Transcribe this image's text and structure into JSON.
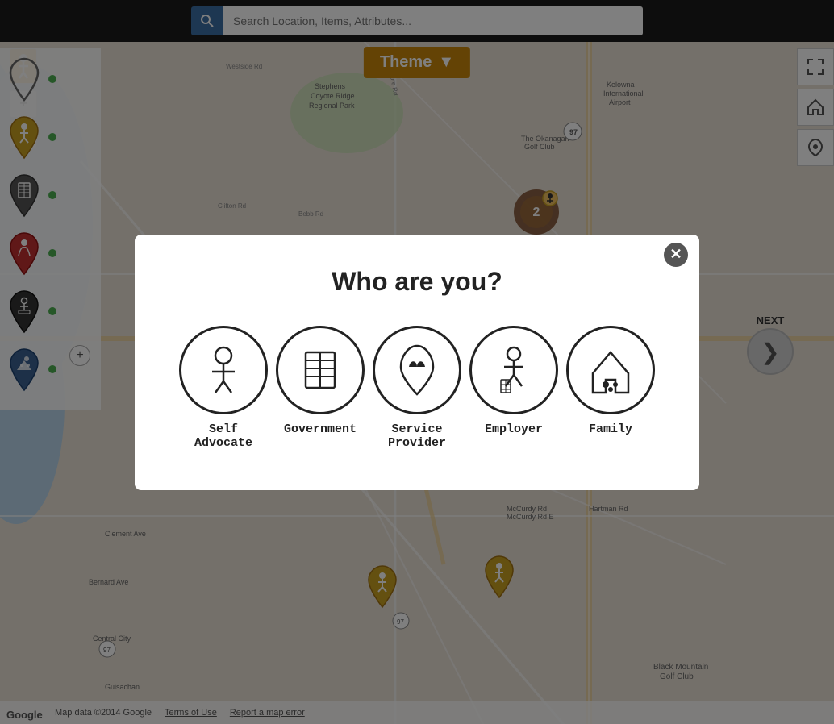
{
  "app": {
    "title": "Who are you?"
  },
  "topbar": {
    "search_placeholder": "Search Location, Items, Attributes..."
  },
  "theme_button": {
    "label": "Theme",
    "arrow": "▼"
  },
  "map_controls": {
    "zoom_in": "+",
    "zoom_out": "−",
    "add": "+"
  },
  "next_button": {
    "label": "NEXT",
    "arrow": "❯"
  },
  "modal": {
    "title": "Who are you?",
    "close": "✕",
    "roles": [
      {
        "id": "self-advocate",
        "label": "Self Advocate"
      },
      {
        "id": "government",
        "label": "Government"
      },
      {
        "id": "service-provider",
        "label": "Service Provider"
      },
      {
        "id": "employer",
        "label": "Employer"
      },
      {
        "id": "family",
        "label": "Family"
      }
    ]
  },
  "bottom_bar": {
    "map_data": "Map data ©2014 Google",
    "terms": "Terms of Use",
    "report": "Report a map error"
  },
  "colors": {
    "theme_btn": "#c8860a",
    "search_btn": "#3a6ea5",
    "modal_close": "#555",
    "cluster_dark": "#7a4a2a",
    "cluster_accent": "#c8860a"
  }
}
